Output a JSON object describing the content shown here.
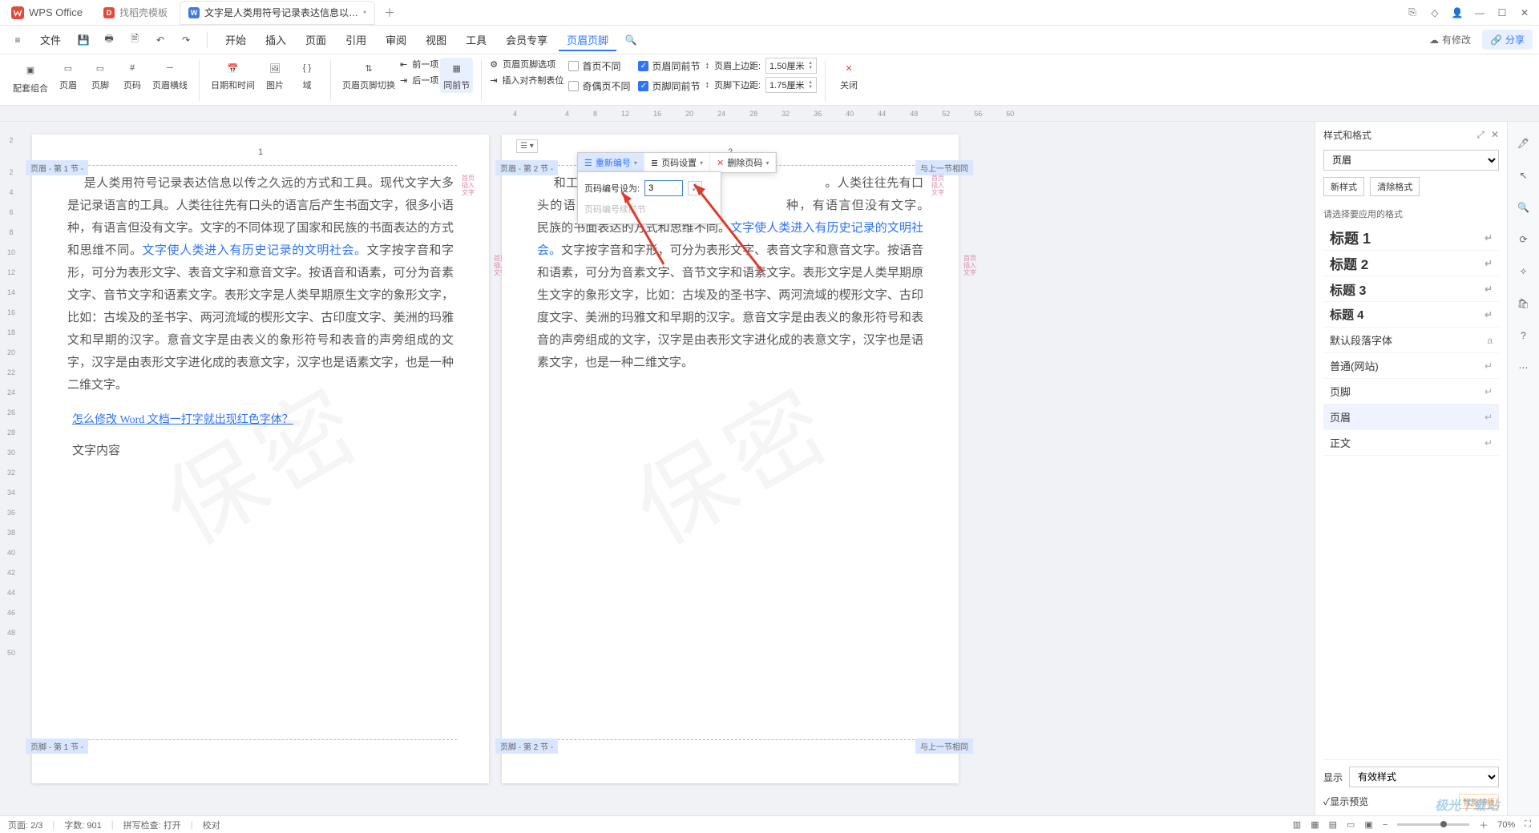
{
  "titlebar": {
    "app": "WPS Office",
    "tabs": [
      {
        "label": "找稻壳模板",
        "icon_bg": "#e24a3b",
        "icon": "D"
      },
      {
        "label": "文字是人类用符号记录表达信息以…",
        "icon_bg": "#3b7ddd",
        "icon": "W",
        "active": true
      }
    ]
  },
  "menubar": {
    "file": "文件",
    "items": [
      "开始",
      "插入",
      "页面",
      "引用",
      "审阅",
      "视图",
      "工具",
      "会员专享",
      "页眉页脚"
    ],
    "active_index": 8,
    "modified": "有修改",
    "share": "分享"
  },
  "ribbon": {
    "g1": {
      "combo": "配套组合",
      "header": "页眉",
      "footer": "页脚",
      "pagenum": "页码",
      "hline": "页眉横线"
    },
    "g2": {
      "datetime": "日期和时间",
      "picture": "图片",
      "field": "域"
    },
    "g3": {
      "switch": "页眉页脚切换",
      "prev": "前一项",
      "next": "后一项",
      "same": "同前节"
    },
    "g4": {
      "options": "页眉页脚选项",
      "align": "插入对齐制表位",
      "chk_firstdiff": "首页不同",
      "chk_oddeven": "奇偶页不同",
      "chk_header_same": "页眉同前节",
      "chk_footer_same": "页脚同前节",
      "header_top_lbl": "页眉上边距:",
      "header_top_val": "1.50厘米",
      "footer_bot_lbl": "页脚下边距:",
      "footer_bot_val": "1.75厘米"
    },
    "g5": {
      "close": "关闭"
    }
  },
  "ruler": {
    "marks": [
      "4",
      "",
      "4",
      "8",
      "12",
      "16",
      "20",
      "24",
      "28",
      "32",
      "36",
      "40",
      "44",
      "48",
      "52",
      "56",
      "60"
    ]
  },
  "left_ruler": [
    "2",
    "",
    "2",
    "4",
    "6",
    "8",
    "10",
    "12",
    "14",
    "16",
    "18",
    "20",
    "22",
    "24",
    "26",
    "28",
    "30",
    "32",
    "34",
    "36",
    "38",
    "40",
    "42",
    "44",
    "46",
    "48",
    "50"
  ],
  "pages": {
    "p1": {
      "header_num": "1",
      "header_tag": "页眉 - 第 1 节 -",
      "footer_tag": "页脚 - 第 1 节 -",
      "body": "是人类用符号记录表达信息以传之久远的方式和工具。现代文字大多是记录语言的工具。人类往往先有口头的语言后产生书面文字，很多小语种，有语言但没有文字。文字的不同体现了国家和民族的书面表达的方式和思维不同。",
      "body_hl": "文字使人类进入有历史记录的文明社会。",
      "body2": "文字按字音和字形，可分为表形文字、表音文字和意音文字。按语音和语素，可分为音素文字、音节文字和语素文字。表形文字是人类早期原生文字的象形文字，比如：古埃及的圣书字、两河流域的楔形文字、古印度文字、美洲的玛雅文和早期的汉字。意音文字是由表义的象形符号和表音的声旁组成的文字，汉字是由表形文字进化成的表意文字，汉字也是语素文字，也是一种二维文字。",
      "link": "怎么修改 Word 文档一打字就出现红色字体？",
      "extra": "文字内容"
    },
    "p2": {
      "header_num": "2",
      "header_tag": "页眉 - 第 2 节 -",
      "header_link": "与上一节相同",
      "footer_tag": "页脚 - 第 2 节 -",
      "footer_link": "与上一节相同",
      "body": "和工具。现代文　　　　　　　　　　　　　　　。人类往往先有口头的语言　　　　　　　　　　　　　　　种，有语言但没有文字。　　　　　　　　　　　　　　　民族的书面表达的方式和思维不同。",
      "body_hl": "文字使人类进入有历史记录的文明社会。",
      "body2": "文字按字音和字形，可分为表形文字、表音文字和意音文字。按语音和语素，可分为音素文字、音节文字和语素文字。表形文字是人类早期原生文字的象形文字，比如：古埃及的圣书字、两河流域的楔形文字、古印度文字、美洲的玛雅文和早期的汉字。意音文字是由表义的象形符号和表音的声旁组成的文字，汉字是由表形文字进化成的表意文字，汉字也是语素文字，也是一种二维文字。"
    },
    "side_label1": "首页",
    "side_label2": "插入 文字",
    "watermark": "保密"
  },
  "popup": {
    "btn_renumber": "重新编号",
    "btn_settings": "页码设置",
    "btn_delete": "删除页码",
    "row_label": "页码编号设为:",
    "row_value": "3",
    "row_continue": "页码编号续前节"
  },
  "stylepanel": {
    "title": "样式和格式",
    "current": "页眉",
    "btn_new": "新样式",
    "btn_clear": "清除格式",
    "choose_label": "请选择要应用的格式",
    "styles": [
      {
        "label": "标题 1",
        "cls": "h1"
      },
      {
        "label": "标题 2",
        "cls": "h2"
      },
      {
        "label": "标题 3",
        "cls": "h3"
      },
      {
        "label": "标题 4",
        "cls": "h4"
      },
      {
        "label": "默认段落字体",
        "cls": "def",
        "ret": "a"
      },
      {
        "label": "普通(网站)",
        "cls": "def"
      },
      {
        "label": "页脚",
        "cls": "def"
      },
      {
        "label": "页眉",
        "cls": "def",
        "sel": true
      },
      {
        "label": "正文",
        "cls": "def"
      }
    ],
    "show_label": "显示",
    "show_value": "有效样式",
    "preview_chk": "显示预览",
    "smart": "智能排版"
  },
  "statusbar": {
    "page": "页面: 2/3",
    "words": "字数: 901",
    "spell": "拼写检查: 打开",
    "proof": "校对",
    "zoom": "70%"
  },
  "brand_wm": "极光下载站"
}
